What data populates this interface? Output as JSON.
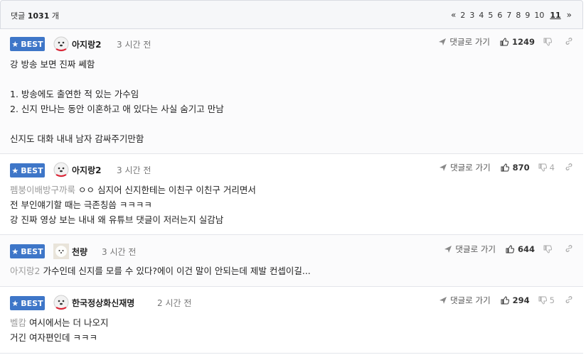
{
  "header": {
    "count_prefix": "댓글",
    "count": "1031",
    "count_suffix": "개",
    "pager": {
      "prev": "«",
      "pages": [
        "2",
        "3",
        "4",
        "5",
        "6",
        "7",
        "8",
        "9",
        "10"
      ],
      "current": "11",
      "next": "»"
    }
  },
  "comments": [
    {
      "badge": "BEST",
      "name": "아지랑2",
      "time": "3 시간 전",
      "goto": "댓글로 가기",
      "likes": "1249",
      "dislikes": "",
      "lines": [
        "강 방송 보면 진짜 쎄함",
        "",
        "1. 방송에도 출연한 적 있는 가수임",
        "2. 신지 만나는 동안 이혼하고 애 있다는 사실 숨기고 만남",
        "",
        "신지도 대화 내내 남자 감싸주기만함"
      ]
    },
    {
      "badge": "BEST",
      "name": "아지랑2",
      "time": "3 시간 전",
      "goto": "댓글로 가기",
      "likes": "870",
      "dislikes": "4",
      "mention": "펨붕이배방구까룩",
      "lines": [
        "ㅇㅇ 심지어 신지한테는 이친구 이친구 거리면서",
        "전 부인얘기할 때는 극존칭씀 ㅋㅋㅋㅋ",
        "강 진짜 영상 보는 내내 왜 유튜브 댓글이 저러는지 실감남"
      ]
    },
    {
      "badge": "BEST",
      "name": "천량",
      "time": "3 시간 전",
      "goto": "댓글로 가기",
      "likes": "644",
      "dislikes": "",
      "mention": "아지랑2",
      "lines": [
        "가수인데 신지를 모를 수 있다?에이 이건 말이 안되는데 제발 컨셉이길..."
      ]
    },
    {
      "badge": "BEST",
      "name": "한국정상화신재명",
      "time": "2 시간 전",
      "goto": "댓글로 가기",
      "likes": "294",
      "dislikes": "5",
      "mention": "벨캄",
      "lines": [
        "여시에서는 더 나오지",
        "거긴 여자편인데 ㅋㅋㅋ"
      ]
    }
  ],
  "colors": {
    "best_badge": "#3e76c8",
    "mention": "#9a9a9a"
  },
  "icons": {
    "star": "star-icon",
    "goto": "paper-plane-icon",
    "like": "thumbs-up-icon",
    "dislike": "thumbs-down-icon",
    "link": "link-icon"
  }
}
